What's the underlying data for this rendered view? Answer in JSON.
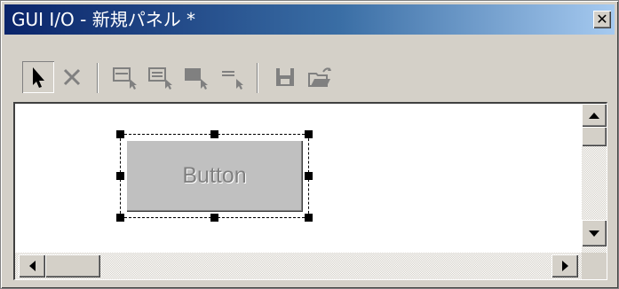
{
  "window": {
    "title": "GUI I/O - 新規パネル *",
    "close_label": "✕"
  },
  "toolbar": {
    "buttons": [
      {
        "name": "select-pointer-icon",
        "pressed": true
      },
      {
        "name": "delete-icon",
        "pressed": false
      },
      {
        "name": "add-button-widget-icon",
        "pressed": false
      },
      {
        "name": "add-textfield-widget-icon",
        "pressed": false
      },
      {
        "name": "add-filled-widget-icon",
        "pressed": false
      },
      {
        "name": "add-label-widget-icon",
        "pressed": false
      },
      {
        "name": "save-icon",
        "pressed": false
      },
      {
        "name": "open-folder-icon",
        "pressed": false
      }
    ]
  },
  "panel": {
    "widget": {
      "label": "Button",
      "selected": true
    }
  },
  "colors": {
    "titlebar_start": "#0a246a",
    "titlebar_end": "#a6caf0",
    "face": "#d4d0c8",
    "widget_face": "#c0c0c0",
    "disabled_text": "#808080"
  }
}
